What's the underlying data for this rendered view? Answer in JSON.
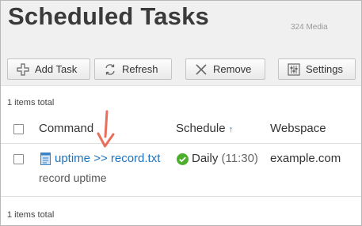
{
  "page": {
    "title": "Scheduled Tasks",
    "watermark": "324 Media"
  },
  "toolbar": {
    "add_label": "Add Task",
    "refresh_label": "Refresh",
    "remove_label": "Remove",
    "settings_label": "Settings"
  },
  "list": {
    "total_top": "1 items total",
    "total_bottom": "1 items total",
    "columns": {
      "command": "Command",
      "schedule": "Schedule",
      "webspace": "Webspace",
      "schedule_sort_indicator": "↑"
    },
    "rows": [
      {
        "command": "uptime >> record.txt",
        "description": "record uptime",
        "schedule": "Daily",
        "schedule_time": "(11:30)",
        "webspace": "example.com"
      }
    ]
  },
  "colors": {
    "link": "#1e73be",
    "ok_green": "#4caf2c",
    "annotation_arrow": "#e8705a",
    "header_bg": "#f0f0f0"
  },
  "icons": {
    "add": "plus-icon",
    "refresh": "refresh-icon",
    "remove": "x-icon",
    "settings": "sliders-icon",
    "command": "script-file-icon",
    "status": "check-circle-icon",
    "annotation": "down-arrow-icon"
  }
}
